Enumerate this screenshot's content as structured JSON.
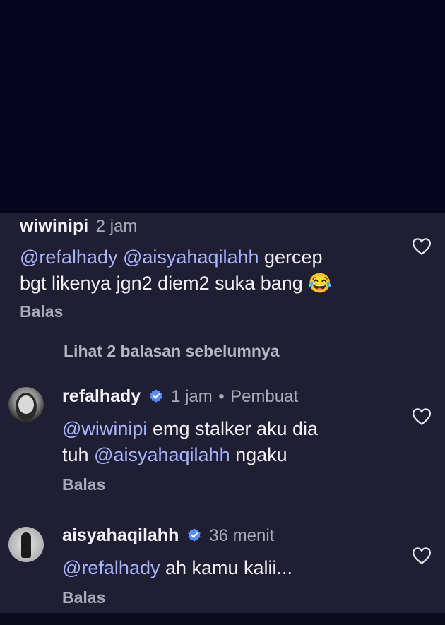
{
  "comments": [
    {
      "username": "wiwinipi",
      "time": "2 jam",
      "body": [
        {
          "text": "@refalhady @aisyahaqilahh",
          "mention": true
        },
        {
          "text": " gercep",
          "mention": false
        }
      ],
      "body_line2": "bgt likenya jgn2 diem2 suka bang",
      "emoji": "😂",
      "reply": "Balas"
    },
    {
      "username": "refalhady",
      "time": "1 jam",
      "separator": "•",
      "role": "Pembuat",
      "mention1": "@wiwinipi",
      "line1_rest": " emg stalker aku dia",
      "line2_start": "tuh ",
      "mention2": "@aisyahaqilahh",
      "line2_rest": " ngaku",
      "reply": "Balas"
    },
    {
      "username": "aisyahaqilahh",
      "time": "36 menit",
      "mention1": "@refalhady",
      "line1_rest": " ah kamu kalii...",
      "reply": "Balas"
    }
  ],
  "view_previous": "Lihat 2 balasan sebelumnya",
  "colors": {
    "mention": "#a8b5ff",
    "panel": "#1f1e33",
    "verified": "#5b8cff"
  },
  "icons": [
    "heart-icon",
    "verified-badge-icon",
    "tears-of-joy-emoji"
  ]
}
